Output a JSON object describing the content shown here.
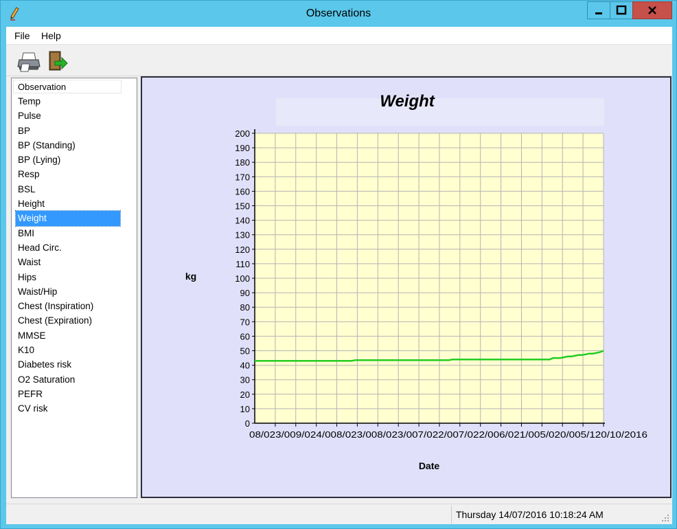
{
  "window": {
    "title": "Observations"
  },
  "menu": [
    {
      "label": "File"
    },
    {
      "label": "Help"
    }
  ],
  "toolbar": {
    "icons": [
      "printer-icon",
      "exit-door-icon"
    ]
  },
  "list": {
    "header": "Observation",
    "items": [
      "Temp",
      "Pulse",
      "BP",
      "BP (Standing)",
      "BP (Lying)",
      "Resp",
      "BSL",
      "Height",
      "Weight",
      "BMI",
      "Head Circ.",
      "Waist",
      "Hips",
      "Waist/Hip",
      "Chest (Inspiration)",
      "Chest (Expiration)",
      "MMSE",
      "K10",
      "Diabetes risk",
      "O2 Saturation",
      "PEFR",
      "CV risk"
    ],
    "selected": "Weight"
  },
  "status": {
    "datetime": "Thursday 14/07/2016 10:18:24 AM"
  },
  "colors": {
    "titlebar": "#5bc7ea",
    "close_button": "#c6504a",
    "selection": "#3399ff",
    "chart_background": "#e0e0fa",
    "plot_background": "#ffffd0",
    "series": "#22cc22"
  },
  "chart_data": {
    "type": "line",
    "title": "Weight",
    "xlabel": "Date",
    "ylabel": "kg",
    "ylim": [
      0,
      200
    ],
    "yticks": [
      0,
      10,
      20,
      30,
      40,
      50,
      60,
      70,
      80,
      90,
      100,
      110,
      120,
      130,
      140,
      150,
      160,
      170,
      180,
      190,
      200
    ],
    "grid": true,
    "x_tick_text": "08/023/009/024/008/023/008/023/007/022/007/022/006/021/005/020/005/120/10/2016",
    "x_tick_count": 17,
    "series": [
      {
        "values": [
          43,
          43,
          43,
          43,
          43,
          43,
          43,
          43,
          43,
          43,
          43,
          43,
          43,
          43,
          43,
          43,
          43,
          43,
          43,
          43,
          43,
          43,
          43,
          43,
          43,
          43,
          43,
          43,
          43.5,
          43.5,
          43.5,
          43.5,
          43.5,
          43.5,
          43.5,
          43.5,
          43.5,
          43.5,
          43.5,
          43.5,
          43.5,
          43.5,
          43.5,
          43.5,
          43.5,
          43.5,
          43.5,
          43.5,
          43.5,
          43.5,
          43.5,
          43.5,
          43.5,
          43.5,
          43.5,
          44,
          44,
          44,
          44,
          44,
          44,
          44,
          44,
          44,
          44,
          44,
          44,
          44,
          44,
          44,
          44,
          44,
          44,
          44,
          44,
          44,
          44,
          44,
          44,
          44,
          44,
          44,
          44,
          45,
          45,
          45,
          45.5,
          46,
          46,
          46.5,
          47,
          47,
          47.5,
          48,
          48,
          48.5,
          49,
          50
        ]
      }
    ]
  }
}
